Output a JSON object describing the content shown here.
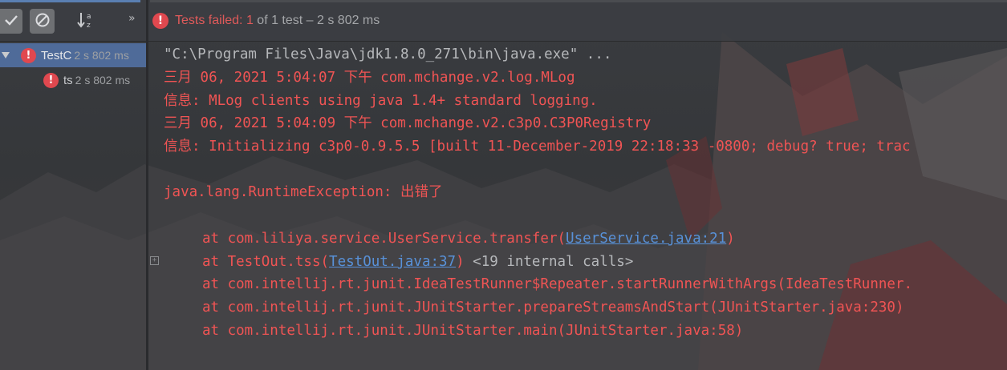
{
  "toolbar": {
    "more_glyph": "»",
    "status_prefix": "Tests failed: ",
    "failed_count": "1",
    "status_suffix": " of 1 test – 2 s 802 ms"
  },
  "tree": {
    "root": {
      "name": "TestC",
      "time": "2 s 802 ms"
    },
    "child": {
      "name": "ts",
      "time": "2 s 802 ms"
    }
  },
  "console": {
    "cmd_line": "\"C:\\Program Files\\Java\\jdk1.8.0_271\\bin\\java.exe\" ...",
    "log1": "三月 06, 2021 5:04:07 下午 com.mchange.v2.log.MLog",
    "log2": "信息: MLog clients using java 1.4+ standard logging.",
    "log3": "三月 06, 2021 5:04:09 下午 com.mchange.v2.c3p0.C3P0Registry",
    "log4": "信息: Initializing c3p0-0.9.5.5 [built 11-December-2019 22:18:33 -0800; debug? true; trac",
    "exception": "java.lang.RuntimeException: 出错了",
    "st1_prefix": "at com.liliya.service.UserService.transfer(",
    "st1_link": "UserService.java:21",
    "st1_suffix": ")",
    "st2_prefix": "at TestOut.tss(",
    "st2_link": "TestOut.java:37",
    "st2_suffix": ") ",
    "st2_internal": "<19 internal calls>",
    "st3": "at com.intellij.rt.junit.IdeaTestRunner$Repeater.startRunnerWithArgs(IdeaTestRunner.",
    "st4": "at com.intellij.rt.junit.JUnitStarter.prepareStreamsAndStart(JUnitStarter.java:230)",
    "st5": "at com.intellij.rt.junit.JUnitStarter.main(JUnitStarter.java:58)"
  },
  "colors": {
    "error_red": "#f05454",
    "link_blue": "#5891d8",
    "selection": "#4f6b99"
  }
}
